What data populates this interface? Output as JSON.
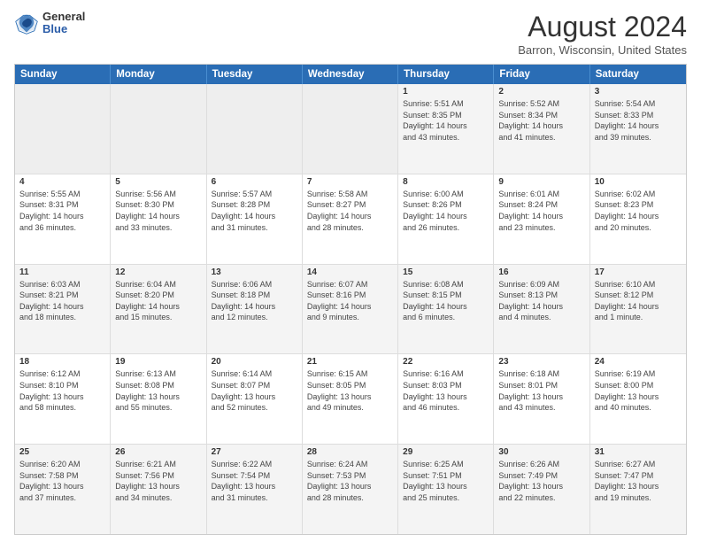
{
  "header": {
    "logo_general": "General",
    "logo_blue": "Blue",
    "month_title": "August 2024",
    "location": "Barron, Wisconsin, United States"
  },
  "calendar": {
    "days_of_week": [
      "Sunday",
      "Monday",
      "Tuesday",
      "Wednesday",
      "Thursday",
      "Friday",
      "Saturday"
    ],
    "rows": [
      [
        {
          "day": "",
          "info": ""
        },
        {
          "day": "",
          "info": ""
        },
        {
          "day": "",
          "info": ""
        },
        {
          "day": "",
          "info": ""
        },
        {
          "day": "1",
          "info": "Sunrise: 5:51 AM\nSunset: 8:35 PM\nDaylight: 14 hours\nand 43 minutes."
        },
        {
          "day": "2",
          "info": "Sunrise: 5:52 AM\nSunset: 8:34 PM\nDaylight: 14 hours\nand 41 minutes."
        },
        {
          "day": "3",
          "info": "Sunrise: 5:54 AM\nSunset: 8:33 PM\nDaylight: 14 hours\nand 39 minutes."
        }
      ],
      [
        {
          "day": "4",
          "info": "Sunrise: 5:55 AM\nSunset: 8:31 PM\nDaylight: 14 hours\nand 36 minutes."
        },
        {
          "day": "5",
          "info": "Sunrise: 5:56 AM\nSunset: 8:30 PM\nDaylight: 14 hours\nand 33 minutes."
        },
        {
          "day": "6",
          "info": "Sunrise: 5:57 AM\nSunset: 8:28 PM\nDaylight: 14 hours\nand 31 minutes."
        },
        {
          "day": "7",
          "info": "Sunrise: 5:58 AM\nSunset: 8:27 PM\nDaylight: 14 hours\nand 28 minutes."
        },
        {
          "day": "8",
          "info": "Sunrise: 6:00 AM\nSunset: 8:26 PM\nDaylight: 14 hours\nand 26 minutes."
        },
        {
          "day": "9",
          "info": "Sunrise: 6:01 AM\nSunset: 8:24 PM\nDaylight: 14 hours\nand 23 minutes."
        },
        {
          "day": "10",
          "info": "Sunrise: 6:02 AM\nSunset: 8:23 PM\nDaylight: 14 hours\nand 20 minutes."
        }
      ],
      [
        {
          "day": "11",
          "info": "Sunrise: 6:03 AM\nSunset: 8:21 PM\nDaylight: 14 hours\nand 18 minutes."
        },
        {
          "day": "12",
          "info": "Sunrise: 6:04 AM\nSunset: 8:20 PM\nDaylight: 14 hours\nand 15 minutes."
        },
        {
          "day": "13",
          "info": "Sunrise: 6:06 AM\nSunset: 8:18 PM\nDaylight: 14 hours\nand 12 minutes."
        },
        {
          "day": "14",
          "info": "Sunrise: 6:07 AM\nSunset: 8:16 PM\nDaylight: 14 hours\nand 9 minutes."
        },
        {
          "day": "15",
          "info": "Sunrise: 6:08 AM\nSunset: 8:15 PM\nDaylight: 14 hours\nand 6 minutes."
        },
        {
          "day": "16",
          "info": "Sunrise: 6:09 AM\nSunset: 8:13 PM\nDaylight: 14 hours\nand 4 minutes."
        },
        {
          "day": "17",
          "info": "Sunrise: 6:10 AM\nSunset: 8:12 PM\nDaylight: 14 hours\nand 1 minute."
        }
      ],
      [
        {
          "day": "18",
          "info": "Sunrise: 6:12 AM\nSunset: 8:10 PM\nDaylight: 13 hours\nand 58 minutes."
        },
        {
          "day": "19",
          "info": "Sunrise: 6:13 AM\nSunset: 8:08 PM\nDaylight: 13 hours\nand 55 minutes."
        },
        {
          "day": "20",
          "info": "Sunrise: 6:14 AM\nSunset: 8:07 PM\nDaylight: 13 hours\nand 52 minutes."
        },
        {
          "day": "21",
          "info": "Sunrise: 6:15 AM\nSunset: 8:05 PM\nDaylight: 13 hours\nand 49 minutes."
        },
        {
          "day": "22",
          "info": "Sunrise: 6:16 AM\nSunset: 8:03 PM\nDaylight: 13 hours\nand 46 minutes."
        },
        {
          "day": "23",
          "info": "Sunrise: 6:18 AM\nSunset: 8:01 PM\nDaylight: 13 hours\nand 43 minutes."
        },
        {
          "day": "24",
          "info": "Sunrise: 6:19 AM\nSunset: 8:00 PM\nDaylight: 13 hours\nand 40 minutes."
        }
      ],
      [
        {
          "day": "25",
          "info": "Sunrise: 6:20 AM\nSunset: 7:58 PM\nDaylight: 13 hours\nand 37 minutes."
        },
        {
          "day": "26",
          "info": "Sunrise: 6:21 AM\nSunset: 7:56 PM\nDaylight: 13 hours\nand 34 minutes."
        },
        {
          "day": "27",
          "info": "Sunrise: 6:22 AM\nSunset: 7:54 PM\nDaylight: 13 hours\nand 31 minutes."
        },
        {
          "day": "28",
          "info": "Sunrise: 6:24 AM\nSunset: 7:53 PM\nDaylight: 13 hours\nand 28 minutes."
        },
        {
          "day": "29",
          "info": "Sunrise: 6:25 AM\nSunset: 7:51 PM\nDaylight: 13 hours\nand 25 minutes."
        },
        {
          "day": "30",
          "info": "Sunrise: 6:26 AM\nSunset: 7:49 PM\nDaylight: 13 hours\nand 22 minutes."
        },
        {
          "day": "31",
          "info": "Sunrise: 6:27 AM\nSunset: 7:47 PM\nDaylight: 13 hours\nand 19 minutes."
        }
      ]
    ]
  }
}
